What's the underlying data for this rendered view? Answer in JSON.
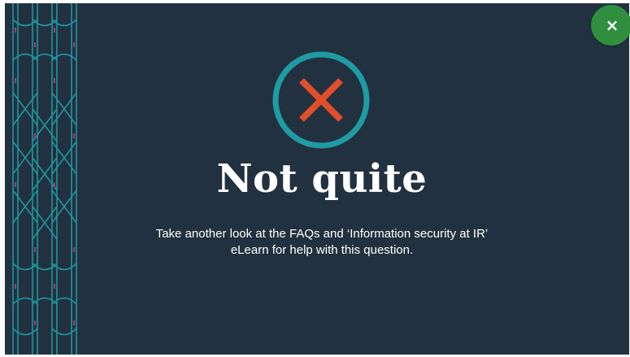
{
  "dialog": {
    "close_button": {
      "label": "×",
      "icon": "close-icon"
    },
    "result_icon": {
      "icon": "x-mark-icon",
      "ring_color": "#1f9ba3",
      "mark_color": "#e04e2c"
    },
    "title": "Not quite",
    "message_line1": "Take another look at the FAQs and ‘Information security at IR’",
    "message_line2": "eLearn for help with this question."
  },
  "colors": {
    "background": "#22313f",
    "pattern_teal": "#1f9ba3",
    "pattern_magenta": "#a23a7a",
    "close_button_bg": "#2f8f3e"
  }
}
